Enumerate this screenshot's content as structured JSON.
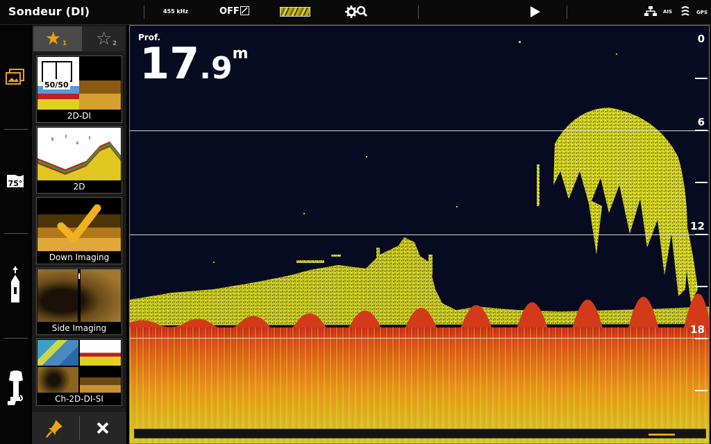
{
  "topbar": {
    "title": "Sondeur (DI)",
    "frequency": "455 kHz",
    "off_label": "OFF",
    "status_icons": {
      "network": "network-icon",
      "ais": "AIS",
      "sonar": "sonar-icon",
      "gps": "GPS"
    }
  },
  "left_rail": {
    "icons": [
      "gallery-icon",
      "water-temperature-icon",
      "boat-icon",
      "outboard-motor-icon"
    ],
    "temperature_value": "75°"
  },
  "favorites": {
    "tabs": [
      {
        "star": "★",
        "number": "1",
        "active": true
      },
      {
        "star": "☆",
        "number": "2",
        "active": false
      }
    ],
    "views": [
      {
        "label": "2D-DI",
        "badge": "50/50"
      },
      {
        "label": "2D"
      },
      {
        "label": "Down Imaging"
      },
      {
        "label": "Side Imaging"
      },
      {
        "label": "Ch-2D-DI-SI"
      }
    ]
  },
  "sonar": {
    "depth_label": "Prof.",
    "depth_int": "17",
    "depth_dec": ".9",
    "depth_unit": "m",
    "scale_labels": [
      "0",
      "6",
      "12",
      "18"
    ]
  },
  "colors": {
    "accent": "#e8a410",
    "water": "#070b22",
    "return_yellow": "#e6e629",
    "bottom_red": "#c6221a"
  }
}
